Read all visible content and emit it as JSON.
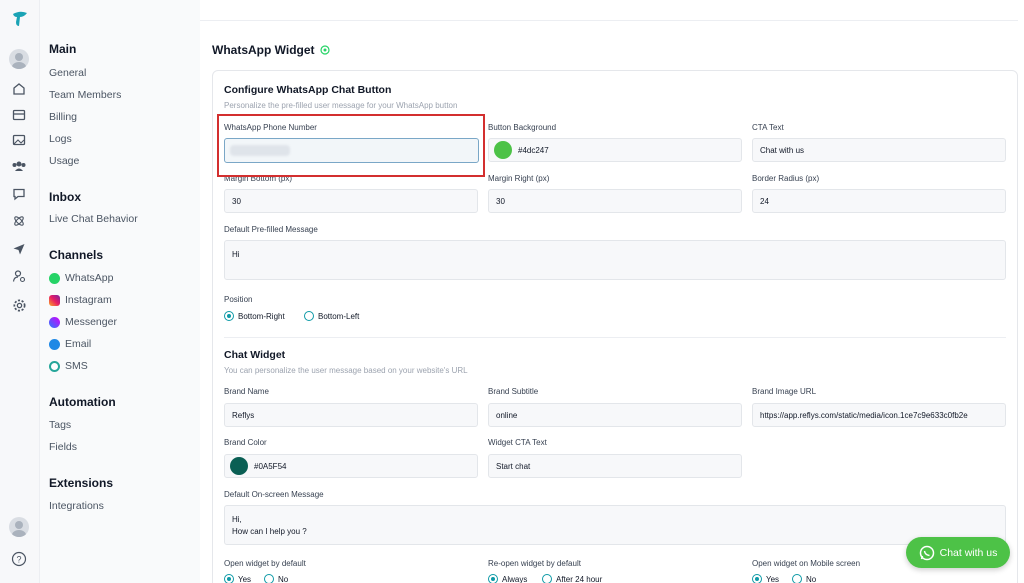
{
  "sidebar": {
    "sections": [
      {
        "title": "Main",
        "items": [
          {
            "label": "General"
          },
          {
            "label": "Team Members"
          },
          {
            "label": "Billing"
          },
          {
            "label": "Logs"
          },
          {
            "label": "Usage"
          }
        ]
      },
      {
        "title": "Inbox",
        "items": [
          {
            "label": "Live Chat Behavior"
          }
        ]
      },
      {
        "title": "Channels",
        "items": [
          {
            "label": "WhatsApp"
          },
          {
            "label": "Instagram"
          },
          {
            "label": "Messenger"
          },
          {
            "label": "Email"
          },
          {
            "label": "SMS"
          }
        ]
      },
      {
        "title": "Automation",
        "items": [
          {
            "label": "Tags"
          },
          {
            "label": "Fields"
          }
        ]
      },
      {
        "title": "Extensions",
        "items": [
          {
            "label": "Integrations"
          }
        ]
      }
    ]
  },
  "page": {
    "title": "WhatsApp Widget"
  },
  "config": {
    "title": "Configure WhatsApp Chat Button",
    "subtitle": "Personalize the pre-filled user message for your WhatsApp button",
    "phone": {
      "label": "WhatsApp Phone Number",
      "value": ""
    },
    "bg": {
      "label": "Button Background",
      "value": "#4dc247",
      "color": "#4dc247"
    },
    "cta": {
      "label": "CTA Text",
      "value": "Chat with us"
    },
    "margin_bottom": {
      "label": "Margin Bottom (px)",
      "value": "30"
    },
    "margin_right": {
      "label": "Margin Right (px)",
      "value": "30"
    },
    "radius": {
      "label": "Border Radius (px)",
      "value": "24"
    },
    "message": {
      "label": "Default Pre-filled Message",
      "value": "Hi"
    },
    "position": {
      "label": "Position",
      "options": [
        "Bottom-Right",
        "Bottom-Left"
      ],
      "selected": "Bottom-Right"
    }
  },
  "widget": {
    "title": "Chat Widget",
    "subtitle": "You can personalize the user message based on your website's URL",
    "brand_name": {
      "label": "Brand Name",
      "value": "Reflys"
    },
    "brand_subtitle": {
      "label": "Brand Subtitle",
      "value": "online"
    },
    "brand_image": {
      "label": "Brand Image URL",
      "value": "https://app.reflys.com/static/media/icon.1ce7c9e633c0fb2e"
    },
    "brand_color": {
      "label": "Brand Color",
      "value": "#0A5F54",
      "color": "#0A5F54"
    },
    "cta": {
      "label": "Widget CTA Text",
      "value": "Start chat"
    },
    "onscreen": {
      "label": "Default On-screen Message",
      "line1": "Hi,",
      "line2": "How can I help you ?"
    },
    "open_default": {
      "label": "Open widget by default",
      "options": [
        "Yes",
        "No"
      ]
    },
    "reopen": {
      "label": "Re-open widget by default",
      "options": [
        "Always",
        "After 24 hour"
      ]
    },
    "mobile": {
      "label": "Open widget on Mobile screen",
      "options": [
        "Yes",
        "No"
      ]
    }
  },
  "floating_button": {
    "label": "Chat with us"
  },
  "colors": {
    "accent": "#0e9aa7",
    "whatsapp": "#4dc247",
    "highlight": "#d32f2f"
  }
}
